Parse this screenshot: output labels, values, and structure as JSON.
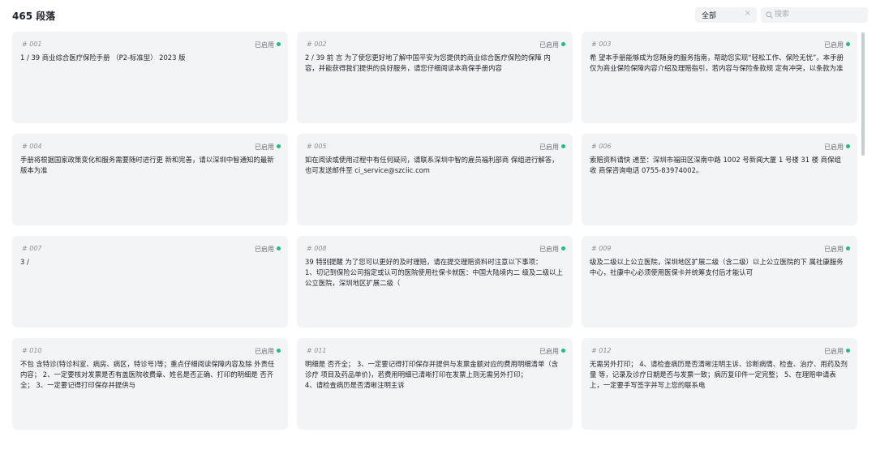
{
  "header": {
    "count_title": "465 段落",
    "filter": {
      "selected": "全部",
      "clear": "×"
    },
    "search": {
      "placeholder": "搜索"
    }
  },
  "cards": [
    {
      "id": "# 001",
      "status": "已启用",
      "text": "1 / 39 商业综合医疗保险手册 （P2-标准型） 2023 版"
    },
    {
      "id": "# 002",
      "status": "已启用",
      "text": "2 / 39 前 言 为了使您更好地了解中国平安为您提供的商业综合医疗保险的保障 内容，并能获得我们提供的良好服务，请您仔细阅读本商保手册内容"
    },
    {
      "id": "# 003",
      "status": "已启用",
      "text": "希 望本手册能够成为您随身的服务指南，帮助您实现“轻松工作、保险无忧”。本手册仅为商业保险保障内容介绍及理赔指引，若内容与保险条款规 定有冲突，以条款为准"
    },
    {
      "id": "# 004",
      "status": "已启用",
      "text": "手册将根据国家政策变化和服务需要随时进行更 新和完善，请以深圳中智通知的最新版本为准"
    },
    {
      "id": "# 005",
      "status": "已启用",
      "text": "如在阅读或使用过程中有任何疑问，请联系深圳中智的雇员福利部商 保组进行解答，也可发送邮件至 ci_service@szciic.com"
    },
    {
      "id": "# 006",
      "status": "已启用",
      "text": "索赔资料请快 递至：深圳市福田区深南中路 1002 号新闻大厦 1 号楼 31 楼 商保组 收 商保咨询电话 0755-83974002。"
    },
    {
      "id": "# 007",
      "status": "已启用",
      "text": "3 /"
    },
    {
      "id": "# 008",
      "status": "已启用",
      "text": "39 特别提醒 为了您可以更好的及时理赔，请在提交理赔资料时注意以下事项：\n1、切记到保险公司指定或认可的医院使用社保卡就医：中国大陆境内二 级及二级以上公立医院，深圳地区扩展二级（"
    },
    {
      "id": "# 009",
      "status": "已启用",
      "text": "级及二级以上公立医院，深圳地区扩展二级（含二级）以上公立医院的下 属社康服务中心，社康中心必须使用医保卡并统筹支付后才能认可"
    },
    {
      "id": "# 010",
      "status": "已启用",
      "text": "不包 含特诊(特诊科室、病房、病区，特诊号)等；重点仔细阅读保障内容及除 外责任内容； 2、一定要核对发票是否有盖医院收费章、姓名是否正确、打印的明细是 否齐全； 3、一定要记得打印保存并提供与"
    },
    {
      "id": "# 011",
      "status": "已启用",
      "text": "明细是 否齐全； 3、一定要记得打印保存并提供与发票金额对应的费用明细清单（含诊疗 项目及药品单价)，若费用明细已清晰打印在发票上则无需另外打印；\n4、请检查病历是否清晰注明主诉"
    },
    {
      "id": "# 012",
      "status": "已启用",
      "text": "无需另外打印； 4、请检查病历是否清晰注明主诉、诊断病情、检查、治疗、用药及剂量 等，记录及诊疗日期是否与发票一致；病历复印件一定完整； 5、在理赔申请表上，一定要手写签字并写上您的联系电"
    }
  ],
  "colors": {
    "card_bg": "#f3f4f6",
    "status_dot": "#1fbf7a",
    "text": "#1f2329"
  }
}
